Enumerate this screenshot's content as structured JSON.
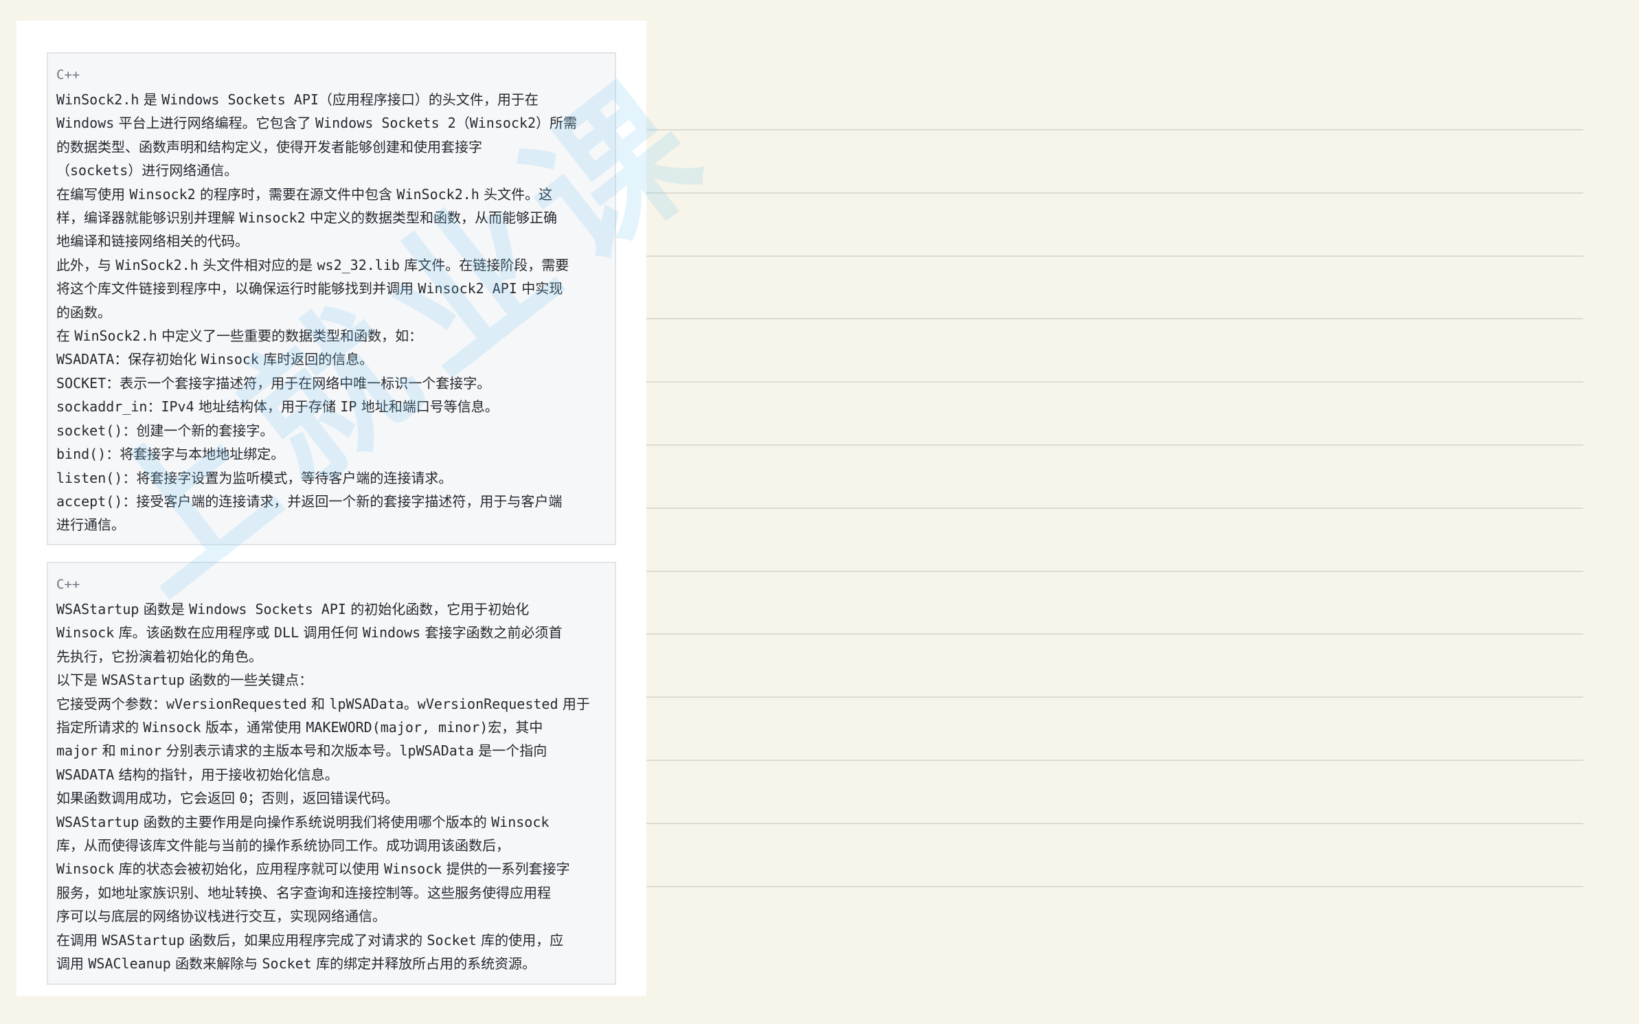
{
  "ruled_line_count": 13,
  "blocks": [
    {
      "lang": "C++",
      "lines": [
        [
          {
            "c": "WinSock2.h",
            "m": true
          },
          {
            "c": " 是 "
          },
          {
            "c": "Windows Sockets API",
            "m": true
          },
          {
            "c": "（应用程序接口）的头文件，用于在"
          }
        ],
        [
          {
            "c": "Windows",
            "m": true
          },
          {
            "c": " 平台上进行网络编程。它包含了 "
          },
          {
            "c": "Windows Sockets 2",
            "m": true
          },
          {
            "c": "（"
          },
          {
            "c": "Winsock2",
            "m": true
          },
          {
            "c": "）所需"
          }
        ],
        [
          {
            "c": "的数据类型、函数声明和结构定义，使得开发者能够创建和使用套接字"
          }
        ],
        [
          {
            "c": "（"
          },
          {
            "c": "sockets",
            "m": true
          },
          {
            "c": "）进行网络通信。"
          }
        ],
        [
          {
            "c": "在编写使用 "
          },
          {
            "c": "Winsock2",
            "m": true
          },
          {
            "c": " 的程序时，需要在源文件中包含 "
          },
          {
            "c": "WinSock2.h",
            "m": true
          },
          {
            "c": " 头文件。这"
          }
        ],
        [
          {
            "c": "样，编译器就能够识别并理解 "
          },
          {
            "c": "Winsock2",
            "m": true
          },
          {
            "c": " 中定义的数据类型和函数，从而能够正确"
          }
        ],
        [
          {
            "c": "地编译和链接网络相关的代码。"
          }
        ],
        [
          {
            "c": "此外，与 "
          },
          {
            "c": "WinSock2.h",
            "m": true
          },
          {
            "c": " 头文件相对应的是 "
          },
          {
            "c": "ws2_32.lib",
            "m": true
          },
          {
            "c": " 库文件。在链接阶段，需要"
          }
        ],
        [
          {
            "c": "将这个库文件链接到程序中，以确保运行时能够找到并调用 "
          },
          {
            "c": "Winsock2 API",
            "m": true
          },
          {
            "c": " 中实现"
          }
        ],
        [
          {
            "c": "的函数。"
          }
        ],
        [
          {
            "c": "在 "
          },
          {
            "c": "WinSock2.h",
            "m": true
          },
          {
            "c": " 中定义了一些重要的数据类型和函数，如："
          }
        ],
        [
          {
            "c": "WSADATA",
            "m": true
          },
          {
            "c": "：保存初始化 "
          },
          {
            "c": "Winsock",
            "m": true
          },
          {
            "c": " 库时返回的信息。"
          }
        ],
        [
          {
            "c": "SOCKET",
            "m": true
          },
          {
            "c": "：表示一个套接字描述符，用于在网络中唯一标识一个套接字。"
          }
        ],
        [
          {
            "c": "sockaddr_in",
            "m": true
          },
          {
            "c": "："
          },
          {
            "c": "IPv4",
            "m": true
          },
          {
            "c": " 地址结构体，用于存储 "
          },
          {
            "c": "IP",
            "m": true
          },
          {
            "c": " 地址和端口号等信息。"
          }
        ],
        [
          {
            "c": "socket()",
            "m": true
          },
          {
            "c": "：创建一个新的套接字。"
          }
        ],
        [
          {
            "c": "bind()",
            "m": true
          },
          {
            "c": "：将套接字与本地地址绑定。"
          }
        ],
        [
          {
            "c": "listen()",
            "m": true
          },
          {
            "c": "：将套接字设置为监听模式，等待客户端的连接请求。"
          }
        ],
        [
          {
            "c": "accept()",
            "m": true
          },
          {
            "c": "：接受客户端的连接请求，并返回一个新的套接字描述符，用于与客户端"
          }
        ],
        [
          {
            "c": "进行通信。"
          }
        ]
      ]
    },
    {
      "lang": "C++",
      "lines": [
        [
          {
            "c": "WSAStartup",
            "m": true
          },
          {
            "c": " 函数是 "
          },
          {
            "c": "Windows Sockets API",
            "m": true
          },
          {
            "c": " 的初始化函数，它用于初始化"
          }
        ],
        [
          {
            "c": "Winsock",
            "m": true
          },
          {
            "c": " 库。该函数在应用程序或 "
          },
          {
            "c": "DLL",
            "m": true
          },
          {
            "c": " 调用任何 "
          },
          {
            "c": "Windows",
            "m": true
          },
          {
            "c": " 套接字函数之前必须首"
          }
        ],
        [
          {
            "c": "先执行，它扮演着初始化的角色。"
          }
        ],
        [
          {
            "c": "以下是 "
          },
          {
            "c": "WSAStartup",
            "m": true
          },
          {
            "c": " 函数的一些关键点："
          }
        ],
        [
          {
            "c": "它接受两个参数："
          },
          {
            "c": "wVersionRequested",
            "m": true
          },
          {
            "c": " 和 "
          },
          {
            "c": "lpWSAData",
            "m": true
          },
          {
            "c": "。"
          },
          {
            "c": "wVersionRequested",
            "m": true
          },
          {
            "c": " 用于"
          }
        ],
        [
          {
            "c": "指定所请求的 "
          },
          {
            "c": "Winsock",
            "m": true
          },
          {
            "c": " 版本，通常使用 "
          },
          {
            "c": "MAKEWORD(major, minor)",
            "m": true
          },
          {
            "c": "宏，其中"
          }
        ],
        [
          {
            "c": "major",
            "m": true
          },
          {
            "c": " 和 "
          },
          {
            "c": "minor",
            "m": true
          },
          {
            "c": " 分别表示请求的主版本号和次版本号。"
          },
          {
            "c": "lpWSAData",
            "m": true
          },
          {
            "c": " 是一个指向"
          }
        ],
        [
          {
            "c": "WSADATA",
            "m": true
          },
          {
            "c": " 结构的指针，用于接收初始化信息。"
          }
        ],
        [
          {
            "c": "如果函数调用成功，它会返回 "
          },
          {
            "c": "0",
            "m": true
          },
          {
            "c": "；否则，返回错误代码。"
          }
        ],
        [
          {
            "c": "WSAStartup",
            "m": true
          },
          {
            "c": " 函数的主要作用是向操作系统说明我们将使用哪个版本的 "
          },
          {
            "c": "Winsock",
            "m": true
          }
        ],
        [
          {
            "c": "库，从而使得该库文件能与当前的操作系统协同工作。成功调用该函数后，"
          }
        ],
        [
          {
            "c": "Winsock",
            "m": true
          },
          {
            "c": " 库的状态会被初始化，应用程序就可以使用 "
          },
          {
            "c": "Winsock",
            "m": true
          },
          {
            "c": " 提供的一系列套接字"
          }
        ],
        [
          {
            "c": "服务，如地址家族识别、地址转换、名字查询和连接控制等。这些服务使得应用程"
          }
        ],
        [
          {
            "c": "序可以与底层的网络协议栈进行交互，实现网络通信。"
          }
        ],
        [
          {
            "c": "在调用 "
          },
          {
            "c": "WSAStartup",
            "m": true
          },
          {
            "c": " 函数后，如果应用程序完成了对请求的 "
          },
          {
            "c": "Socket",
            "m": true
          },
          {
            "c": " 库的使用，应"
          }
        ],
        [
          {
            "c": "调用 "
          },
          {
            "c": "WSACleanup",
            "m": true
          },
          {
            "c": " 函数来解除与 "
          },
          {
            "c": "Socket",
            "m": true
          },
          {
            "c": " 库的绑定并释放所占用的系统资源。"
          }
        ]
      ]
    }
  ]
}
